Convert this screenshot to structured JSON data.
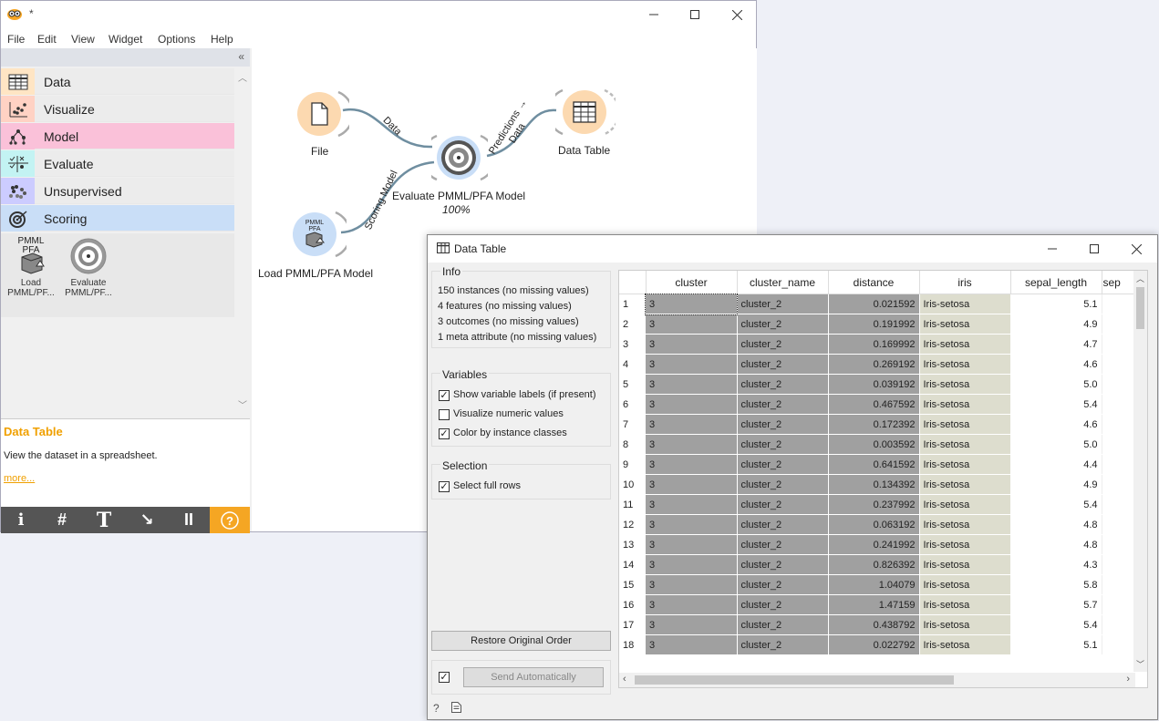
{
  "main": {
    "title": "*",
    "menu": [
      "File",
      "Edit",
      "View",
      "Widget",
      "Options",
      "Help"
    ],
    "collapse_glyph": "«",
    "categories": [
      {
        "label": "Data",
        "color": "#ffe5c4",
        "icon": "data-table-icon"
      },
      {
        "label": "Visualize",
        "color": "#ffd2c4",
        "icon": "scatter-icon"
      },
      {
        "label": "Model",
        "color": "#fac1d9",
        "icon": "tree-icon"
      },
      {
        "label": "Evaluate",
        "color": "#c3f3f3",
        "icon": "evaluate-icon"
      },
      {
        "label": "Unsupervised",
        "color": "#ccccff",
        "icon": "clusters-icon"
      },
      {
        "label": "Scoring",
        "color": "#c9def7",
        "icon": "scoring-icon"
      }
    ],
    "widgets": [
      {
        "line1": "Load",
        "line2": "PMML/PF...",
        "icon_text": "PMML\nPFA"
      },
      {
        "line1": "Evaluate",
        "line2": "PMML/PF..."
      }
    ],
    "help": {
      "title": "Data Table",
      "description": "View the dataset in a spreadsheet.",
      "more": "more..."
    },
    "toolbar": [
      "i",
      "#",
      "T",
      "↘",
      "II",
      "?"
    ]
  },
  "canvas": {
    "nodes": {
      "file": "File",
      "evaluate": "Evaluate PMML/PFA Model",
      "evaluate_progress": "100%",
      "data_table": "Data Table",
      "load": "Load PMML/PFA Model",
      "load_icon_text": "PMML\nPFA"
    },
    "links": {
      "file_eval": "Data",
      "eval_table_1": "Predictions →",
      "eval_table_2": "Data",
      "load_eval": "Scoring Model"
    }
  },
  "data_table_window": {
    "title": "Data Table",
    "info": {
      "title": "Info",
      "lines": [
        "150 instances (no missing values)",
        "4 features (no missing values)",
        "3 outcomes (no missing values)",
        "1 meta attribute (no missing values)"
      ]
    },
    "variables": {
      "title": "Variables",
      "options": [
        {
          "label": "Show variable labels (if present)",
          "checked": true
        },
        {
          "label": "Visualize numeric values",
          "checked": false
        },
        {
          "label": "Color by instance classes",
          "checked": true
        }
      ]
    },
    "selection": {
      "title": "Selection",
      "options": [
        {
          "label": "Select full rows",
          "checked": true
        }
      ]
    },
    "restore_button": "Restore Original Order",
    "send_button": "Send Automatically",
    "columns": [
      "cluster",
      "cluster_name",
      "distance",
      "iris",
      "sepal_length",
      "sep"
    ],
    "rows": [
      [
        "1",
        "3",
        "cluster_2",
        "0.021592",
        "Iris-setosa",
        "5.1"
      ],
      [
        "2",
        "3",
        "cluster_2",
        "0.191992",
        "Iris-setosa",
        "4.9"
      ],
      [
        "3",
        "3",
        "cluster_2",
        "0.169992",
        "Iris-setosa",
        "4.7"
      ],
      [
        "4",
        "3",
        "cluster_2",
        "0.269192",
        "Iris-setosa",
        "4.6"
      ],
      [
        "5",
        "3",
        "cluster_2",
        "0.039192",
        "Iris-setosa",
        "5.0"
      ],
      [
        "6",
        "3",
        "cluster_2",
        "0.467592",
        "Iris-setosa",
        "5.4"
      ],
      [
        "7",
        "3",
        "cluster_2",
        "0.172392",
        "Iris-setosa",
        "4.6"
      ],
      [
        "8",
        "3",
        "cluster_2",
        "0.003592",
        "Iris-setosa",
        "5.0"
      ],
      [
        "9",
        "3",
        "cluster_2",
        "0.641592",
        "Iris-setosa",
        "4.4"
      ],
      [
        "10",
        "3",
        "cluster_2",
        "0.134392",
        "Iris-setosa",
        "4.9"
      ],
      [
        "11",
        "3",
        "cluster_2",
        "0.237992",
        "Iris-setosa",
        "5.4"
      ],
      [
        "12",
        "3",
        "cluster_2",
        "0.063192",
        "Iris-setosa",
        "4.8"
      ],
      [
        "13",
        "3",
        "cluster_2",
        "0.241992",
        "Iris-setosa",
        "4.8"
      ],
      [
        "14",
        "3",
        "cluster_2",
        "0.826392",
        "Iris-setosa",
        "4.3"
      ],
      [
        "15",
        "3",
        "cluster_2",
        "1.04079",
        "Iris-setosa",
        "5.8"
      ],
      [
        "16",
        "3",
        "cluster_2",
        "1.47159",
        "Iris-setosa",
        "5.7"
      ],
      [
        "17",
        "3",
        "cluster_2",
        "0.438792",
        "Iris-setosa",
        "5.4"
      ],
      [
        "18",
        "3",
        "cluster_2",
        "0.022792",
        "Iris-setosa",
        "5.1"
      ]
    ]
  }
}
